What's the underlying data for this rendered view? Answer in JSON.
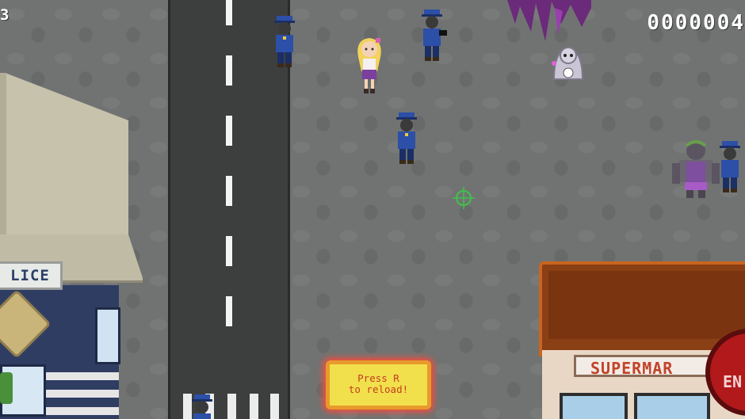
{
  "hud": {
    "lives": "3",
    "score": "0000004"
  },
  "reload_prompt": {
    "line1": "Press R",
    "line2": "to reload!"
  },
  "buildings": {
    "police_sign": "LICE",
    "supermarket_sign": "SUPERMAR",
    "end_button": "EN"
  },
  "colors": {
    "road": "#3d3f3e",
    "pavement": "#717372",
    "police_uniform": "#2c4fa8",
    "reload_box": "#f1e04b",
    "reload_glow": "#ff4a3a",
    "crosshair": "#3fc24a",
    "market_roof": "#8b3f15",
    "end_button": "#b2191b"
  },
  "sprites": {
    "player": "blonde-girl-player",
    "police": "police-officer-enemy",
    "zombie": "purple-zombie-enemy",
    "ghost": "pale-ghost-enemy"
  }
}
